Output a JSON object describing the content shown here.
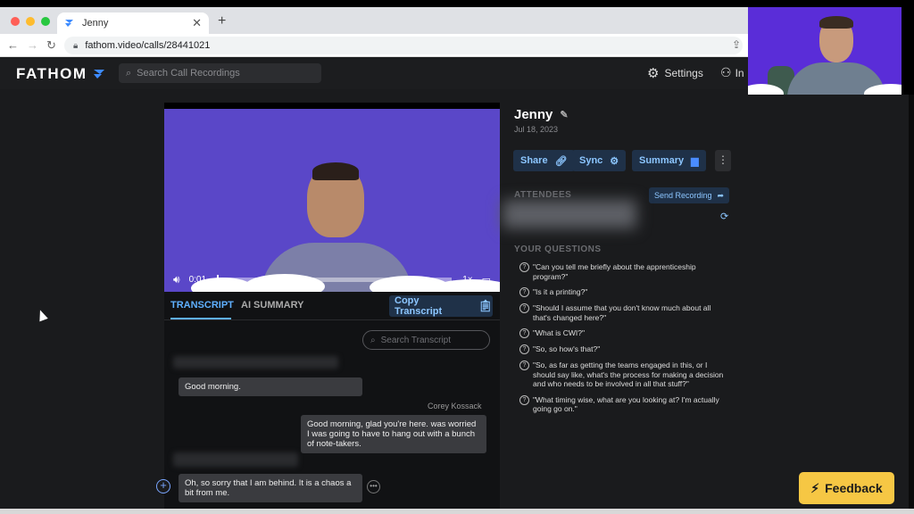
{
  "colors": {
    "accent": "#5fb0ff",
    "video_bg": "#5a47c8",
    "feedback_bg": "#f6c744"
  },
  "browser": {
    "tab_title": "Jenny",
    "url": "fathom.video/calls/28441021"
  },
  "header": {
    "logo": "FATHOM",
    "search_placeholder": "Search Call Recordings",
    "settings_label": "Settings",
    "invite_label": "In"
  },
  "player": {
    "time": "0:01",
    "speed": "1×",
    "progress_fraction": 0.01
  },
  "transcript": {
    "tabs": [
      "TRANSCRIPT",
      "AI SUMMARY"
    ],
    "copy_label": "Copy Transcript",
    "search_placeholder": "Search Transcript",
    "messages": [
      {
        "text": "Good morning."
      },
      {
        "speaker": "Corey Kossack",
        "text": "Good morning, glad you're here. was worried I was going to have to hang out with a bunch of note-takers."
      },
      {
        "text": "Oh, so sorry that I am behind. It is a chaos a bit from me."
      }
    ]
  },
  "call": {
    "name": "Jenny",
    "date": "Jul 18, 2023",
    "buttons": {
      "share": "Share",
      "sync": "Sync",
      "summary": "Summary"
    },
    "attendees_title": "ATTENDEES",
    "send_recording": "Send Recording",
    "questions_title": "YOUR QUESTIONS",
    "questions": [
      "\"Can you tell me briefly about the apprenticeship program?\"",
      "\"Is it a printing?\"",
      "\"Should I assume that you don't know much about all that's changed here?\"",
      "\"What is CWI?\"",
      "\"So, so how's that?\"",
      "\"So, as far as getting the teams engaged in this, or I should say like, what's the process for making a decision and who needs to be involved in all that stuff?\"",
      "\"What timing wise, what are you looking at? I'm actually going go on.\""
    ]
  },
  "feedback": {
    "label": "Feedback"
  }
}
